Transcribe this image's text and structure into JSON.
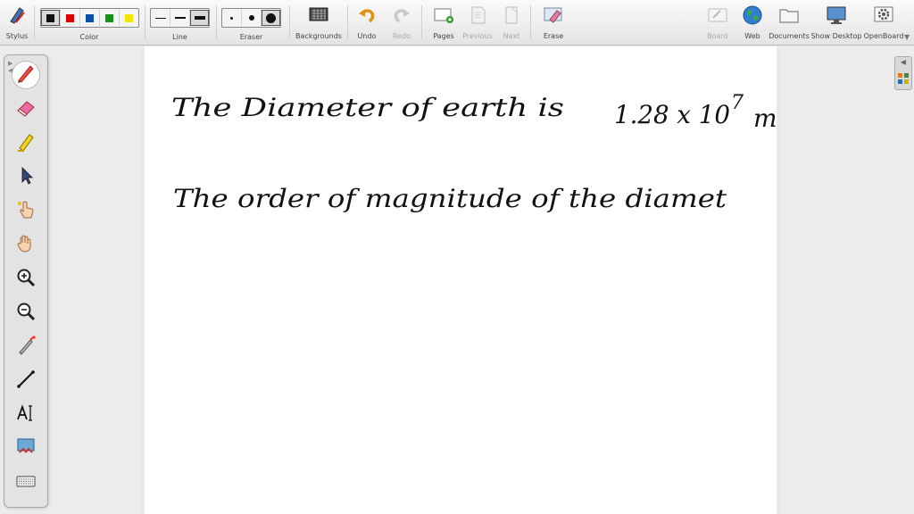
{
  "toolbar": {
    "stylus": "Stylus",
    "color": "Color",
    "line": "Line",
    "eraser": "Eraser",
    "backgrounds": "Backgrounds",
    "undo": "Undo",
    "redo": "Redo",
    "pages": "Pages",
    "previous": "Previous",
    "next": "Next",
    "erase": "Erase",
    "board": "Board",
    "web": "Web",
    "documents": "Documents",
    "show_desktop": "Show Desktop",
    "openboard": "OpenBoard"
  },
  "colors": [
    "#111111",
    "#e00000",
    "#0a4fa8",
    "#1a8f1a",
    "#f5e400"
  ],
  "palette_tools": [
    "pen-icon",
    "eraser-icon",
    "highlighter-icon",
    "selector-icon",
    "pointer-icon",
    "hand-icon",
    "zoom-in-icon",
    "zoom-out-icon",
    "laser-icon",
    "line-icon",
    "text-icon",
    "capture-icon",
    "keyboard-icon"
  ],
  "board": {
    "line1": "The Diameter of earth is",
    "value": "1.28 x 10",
    "exponent": "7",
    "unit": "m",
    "line2": "The order of magnitude of the diamet"
  }
}
